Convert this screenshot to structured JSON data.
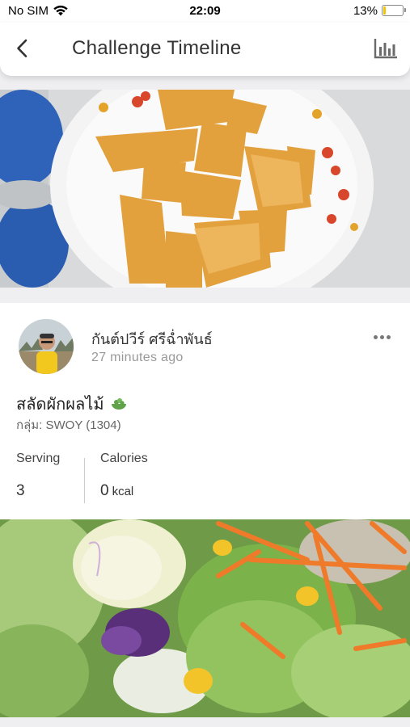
{
  "status_bar": {
    "carrier": "No SIM",
    "time": "22:09",
    "battery_percent": "13%",
    "battery_level": 0.13
  },
  "header": {
    "title": "Challenge Timeline",
    "back_icon": "chevron-left-icon",
    "chart_icon": "bar-chart-icon"
  },
  "post": {
    "user_name": "กันต์ปวีร์ ศรีฉ่ำพันธ์",
    "time_ago": "27 minutes ago",
    "title": "สลัดผักผลไม้",
    "title_icon": "salad-bowl-icon",
    "group": "กลุ่ม: SWOY (1304)",
    "stats": {
      "serving_label": "Serving",
      "serving_value": "3",
      "calories_label": "Calories",
      "calories_value": "0",
      "calories_unit": "kcal"
    }
  },
  "colors": {
    "background": "#efeff1",
    "header": "#ffffff",
    "icon": "#6a6a6a",
    "salad_icon": "#5fa24a"
  }
}
